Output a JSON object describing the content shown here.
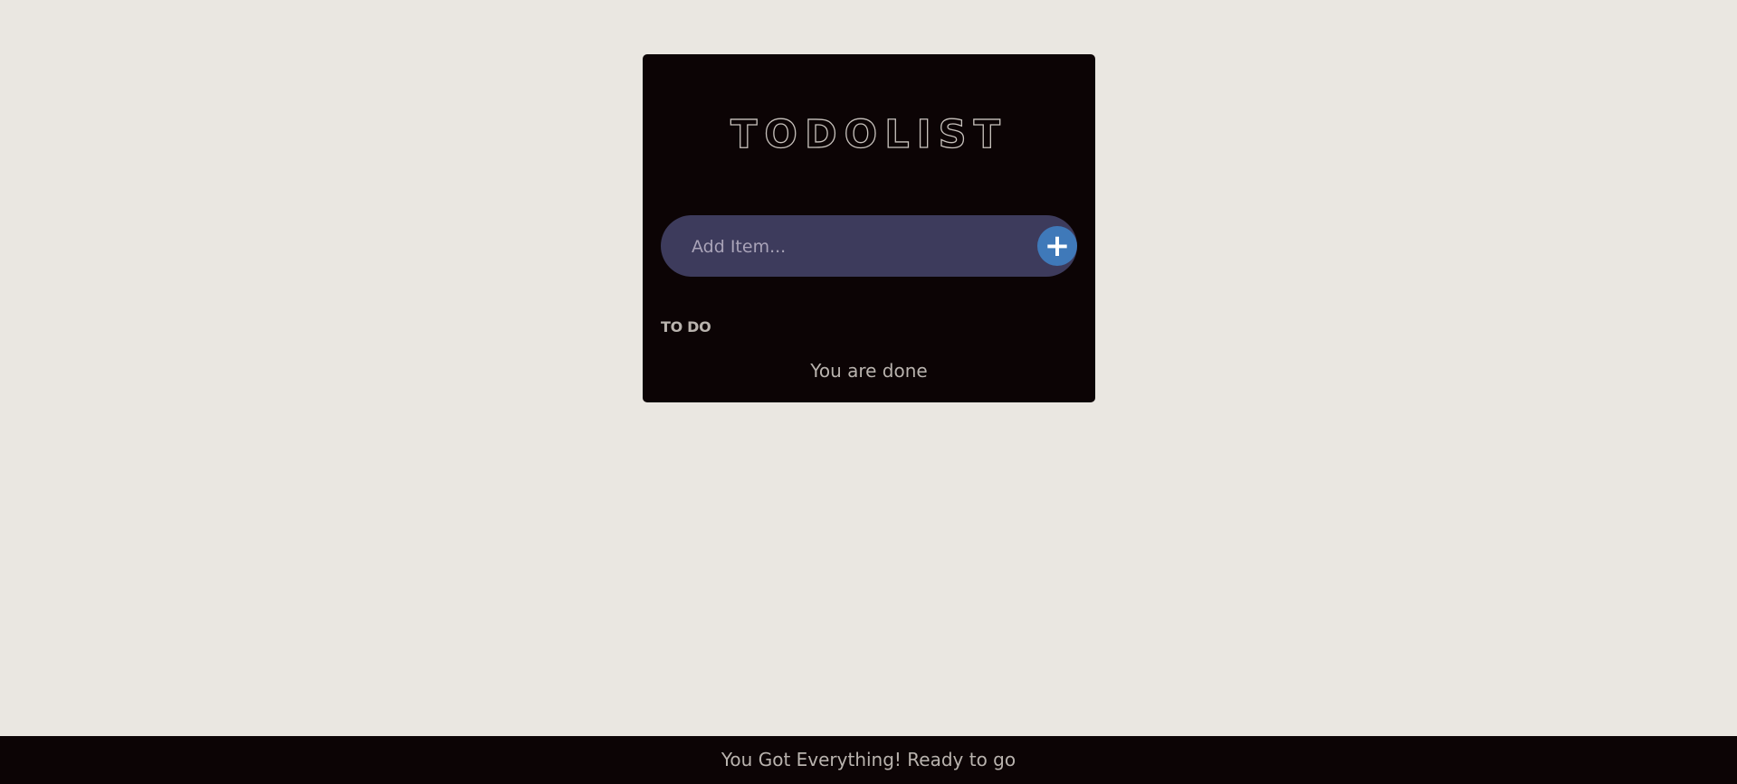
{
  "app": {
    "title": "TODOLIST"
  },
  "input": {
    "placeholder": "Add Item...",
    "value": ""
  },
  "add_button": {
    "label": "+",
    "icon": "plus-icon",
    "color": "#3f79b9"
  },
  "list": {
    "section_label": "TO DO",
    "empty_message": "You are done"
  },
  "footer": {
    "text": "You Got Everything! Ready to go"
  },
  "colors": {
    "page_background": "#eae7e1",
    "card_background": "#0c0405",
    "input_background": "#3d3b5c",
    "text_muted": "#b9b3ae"
  }
}
